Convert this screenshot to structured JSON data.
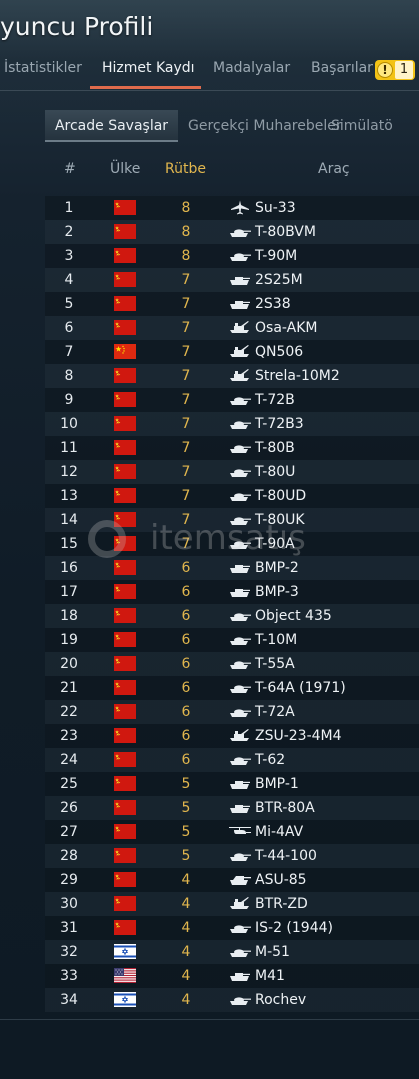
{
  "page": {
    "title": "yuncu Profili"
  },
  "tabs": [
    {
      "label": "İstatistikler",
      "active": false
    },
    {
      "label": "Hizmet Kaydı",
      "active": true
    },
    {
      "label": "Madalyalar",
      "active": false
    },
    {
      "label": "Başarılar",
      "active": false
    }
  ],
  "notification_badge": {
    "count": "1",
    "icon": "exclamation-icon",
    "color": "#f3c316"
  },
  "subtabs": [
    {
      "label": "Arcade Savaşlar",
      "active": true
    },
    {
      "label": "Gerçekçi Muharebeler",
      "active": false
    },
    {
      "label": "Simülatö",
      "active": false
    }
  ],
  "columns": {
    "num": "#",
    "country": "Ülke",
    "rank": "Rütbe",
    "vehicle": "Araç"
  },
  "colors": {
    "rank": "#e1b64e",
    "accent": "#e06b4c"
  },
  "watermark": {
    "text": "itemsatış"
  },
  "rows": [
    {
      "num": "1",
      "country": "ussr",
      "rank": "8",
      "vehicle": "Su-33",
      "icon": "jet-icon"
    },
    {
      "num": "2",
      "country": "ussr",
      "rank": "8",
      "vehicle": "T-80BVM",
      "icon": "tank-icon"
    },
    {
      "num": "3",
      "country": "ussr",
      "rank": "8",
      "vehicle": "T-90M",
      "icon": "tank-icon"
    },
    {
      "num": "4",
      "country": "ussr",
      "rank": "7",
      "vehicle": "2S25M",
      "icon": "light-tank-icon"
    },
    {
      "num": "5",
      "country": "ussr",
      "rank": "7",
      "vehicle": "2S38",
      "icon": "light-tank-icon"
    },
    {
      "num": "6",
      "country": "ussr",
      "rank": "7",
      "vehicle": "Osa-AKM",
      "icon": "spaa-icon"
    },
    {
      "num": "7",
      "country": "china",
      "rank": "7",
      "vehicle": "QN506",
      "icon": "spaa-icon"
    },
    {
      "num": "8",
      "country": "ussr",
      "rank": "7",
      "vehicle": "Strela-10M2",
      "icon": "spaa-icon"
    },
    {
      "num": "9",
      "country": "ussr",
      "rank": "7",
      "vehicle": "T-72B",
      "icon": "tank-icon"
    },
    {
      "num": "10",
      "country": "ussr",
      "rank": "7",
      "vehicle": "T-72B3",
      "icon": "tank-icon"
    },
    {
      "num": "11",
      "country": "ussr",
      "rank": "7",
      "vehicle": "T-80B",
      "icon": "tank-icon"
    },
    {
      "num": "12",
      "country": "ussr",
      "rank": "7",
      "vehicle": "T-80U",
      "icon": "tank-icon"
    },
    {
      "num": "13",
      "country": "ussr",
      "rank": "7",
      "vehicle": "T-80UD",
      "icon": "tank-icon"
    },
    {
      "num": "14",
      "country": "ussr",
      "rank": "7",
      "vehicle": "T-80UK",
      "icon": "tank-icon"
    },
    {
      "num": "15",
      "country": "ussr",
      "rank": "7",
      "vehicle": "T-90A",
      "icon": "tank-icon"
    },
    {
      "num": "16",
      "country": "ussr",
      "rank": "6",
      "vehicle": "BMP-2",
      "icon": "light-tank-icon"
    },
    {
      "num": "17",
      "country": "ussr",
      "rank": "6",
      "vehicle": "BMP-3",
      "icon": "light-tank-icon"
    },
    {
      "num": "18",
      "country": "ussr",
      "rank": "6",
      "vehicle": "Object 435",
      "icon": "tank-icon"
    },
    {
      "num": "19",
      "country": "ussr",
      "rank": "6",
      "vehicle": "T-10M",
      "icon": "tank-icon"
    },
    {
      "num": "20",
      "country": "ussr",
      "rank": "6",
      "vehicle": "T-55A",
      "icon": "tank-icon"
    },
    {
      "num": "21",
      "country": "ussr",
      "rank": "6",
      "vehicle": "T-64A (1971)",
      "icon": "tank-icon"
    },
    {
      "num": "22",
      "country": "ussr",
      "rank": "6",
      "vehicle": "T-72A",
      "icon": "tank-icon"
    },
    {
      "num": "23",
      "country": "ussr",
      "rank": "6",
      "vehicle": "ZSU-23-4M4",
      "icon": "spaa-icon"
    },
    {
      "num": "24",
      "country": "ussr",
      "rank": "6",
      "vehicle": "T-62",
      "icon": "tank-icon"
    },
    {
      "num": "25",
      "country": "ussr",
      "rank": "5",
      "vehicle": "BMP-1",
      "icon": "light-tank-icon"
    },
    {
      "num": "26",
      "country": "ussr",
      "rank": "5",
      "vehicle": "BTR-80A",
      "icon": "light-tank-icon"
    },
    {
      "num": "27",
      "country": "ussr",
      "rank": "5",
      "vehicle": "Mi-4AV",
      "icon": "helicopter-icon"
    },
    {
      "num": "28",
      "country": "ussr",
      "rank": "5",
      "vehicle": "T-44-100",
      "icon": "tank-icon"
    },
    {
      "num": "29",
      "country": "ussr",
      "rank": "4",
      "vehicle": "ASU-85",
      "icon": "tank-destroyer-icon"
    },
    {
      "num": "30",
      "country": "ussr",
      "rank": "4",
      "vehicle": "BTR-ZD",
      "icon": "spaa-icon"
    },
    {
      "num": "31",
      "country": "ussr",
      "rank": "4",
      "vehicle": "IS-2 (1944)",
      "icon": "tank-icon"
    },
    {
      "num": "32",
      "country": "israel",
      "rank": "4",
      "vehicle": "M-51",
      "icon": "tank-icon"
    },
    {
      "num": "33",
      "country": "usa",
      "rank": "4",
      "vehicle": "M41",
      "icon": "light-tank-icon"
    },
    {
      "num": "34",
      "country": "israel",
      "rank": "4",
      "vehicle": "Rochev",
      "icon": "tank-icon"
    }
  ]
}
